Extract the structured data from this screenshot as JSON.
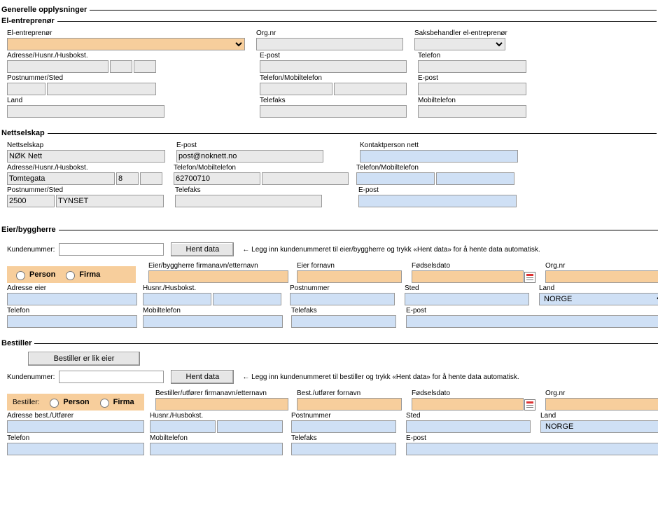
{
  "section_general": "Generelle opplysninger",
  "el": {
    "legend": "El-entreprenør",
    "entrepreneur_label": "El-entreprenør",
    "orgnr_label": "Org.nr",
    "saksbehandler_label": "Saksbehandler el-entreprenør",
    "adresse_label": "Adresse/Husnr./Husbokst.",
    "epost_label": "E-post",
    "telefon_label": "Telefon",
    "poststed_label": "Postnummer/Sted",
    "telmob_label": "Telefon/Mobiltelefon",
    "epost2_label": "E-post",
    "land_label": "Land",
    "telefaks_label": "Telefaks",
    "mobil_label": "Mobiltelefon"
  },
  "nett": {
    "legend": "Nettselskap",
    "nettselskap_label": "Nettselskap",
    "nettselskap_value": "NØK Nett",
    "epost_label": "E-post",
    "epost_value": "post@noknett.no",
    "kontakt_label": "Kontaktperson nett",
    "adresse_label": "Adresse/Husnr./Husbokst.",
    "adresse_value": "Tomtegata",
    "husnr_value": "8",
    "telmob_label": "Telefon/Mobiltelefon",
    "telmob_value": "62700710",
    "kontakt_tel_label": "Telefon/Mobiltelefon",
    "poststed_label": "Postnummer/Sted",
    "postnr_value": "2500",
    "sted_value": "TYNSET",
    "telefaks_label": "Telefaks",
    "kontakt_epost_label": "E-post"
  },
  "eier": {
    "legend": "Eier/byggherre",
    "kunde_label": "Kundenummer:",
    "hent_btn": "Hent data",
    "hint": "← Legg inn kundenummeret til eier/byggherre og trykk «Hent data» for å hente data automatisk.",
    "person_label": "Person",
    "firma_label": "Firma",
    "firmanavn_label": "Eier/byggherre firmanavn/etternavn",
    "fornavn_label": "Eier fornavn",
    "fodsel_label": "Fødselsdato",
    "orgnr_label": "Org.nr",
    "adresse_label": "Adresse eier",
    "husnr_label": "Husnr./Husbokst.",
    "postnr_label": "Postnummer",
    "sted_label": "Sted",
    "land_label": "Land",
    "land_value": "NORGE",
    "telefon_label": "Telefon",
    "mobil_label": "Mobiltelefon",
    "telefaks_label": "Telefaks",
    "epost_label": "E-post"
  },
  "best": {
    "legend": "Bestiller",
    "lik_eier_btn": "Bestiller er lik eier",
    "kunde_label": "Kundenummer:",
    "hent_btn": "Hent data",
    "hint": "← Legg inn kundenummeret til bestiller og trykk «Hent data» for å hente data automatisk.",
    "bestiller_caption": "Bestiller:",
    "person_label": "Person",
    "firma_label": "Firma",
    "firmanavn_label": "Bestiller/utfører firmanavn/etternavn",
    "fornavn_label": "Best./utfører fornavn",
    "fodsel_label": "Fødselsdato",
    "orgnr_label": "Org.nr",
    "adresse_label": "Adresse best./Utfører",
    "husnr_label": "Husnr./Husbokst.",
    "postnr_label": "Postnummer",
    "sted_label": "Sted",
    "land_label": "Land",
    "land_value": "NORGE",
    "telefon_label": "Telefon",
    "mobil_label": "Mobiltelefon",
    "telefaks_label": "Telefaks",
    "epost_label": "E-post"
  }
}
